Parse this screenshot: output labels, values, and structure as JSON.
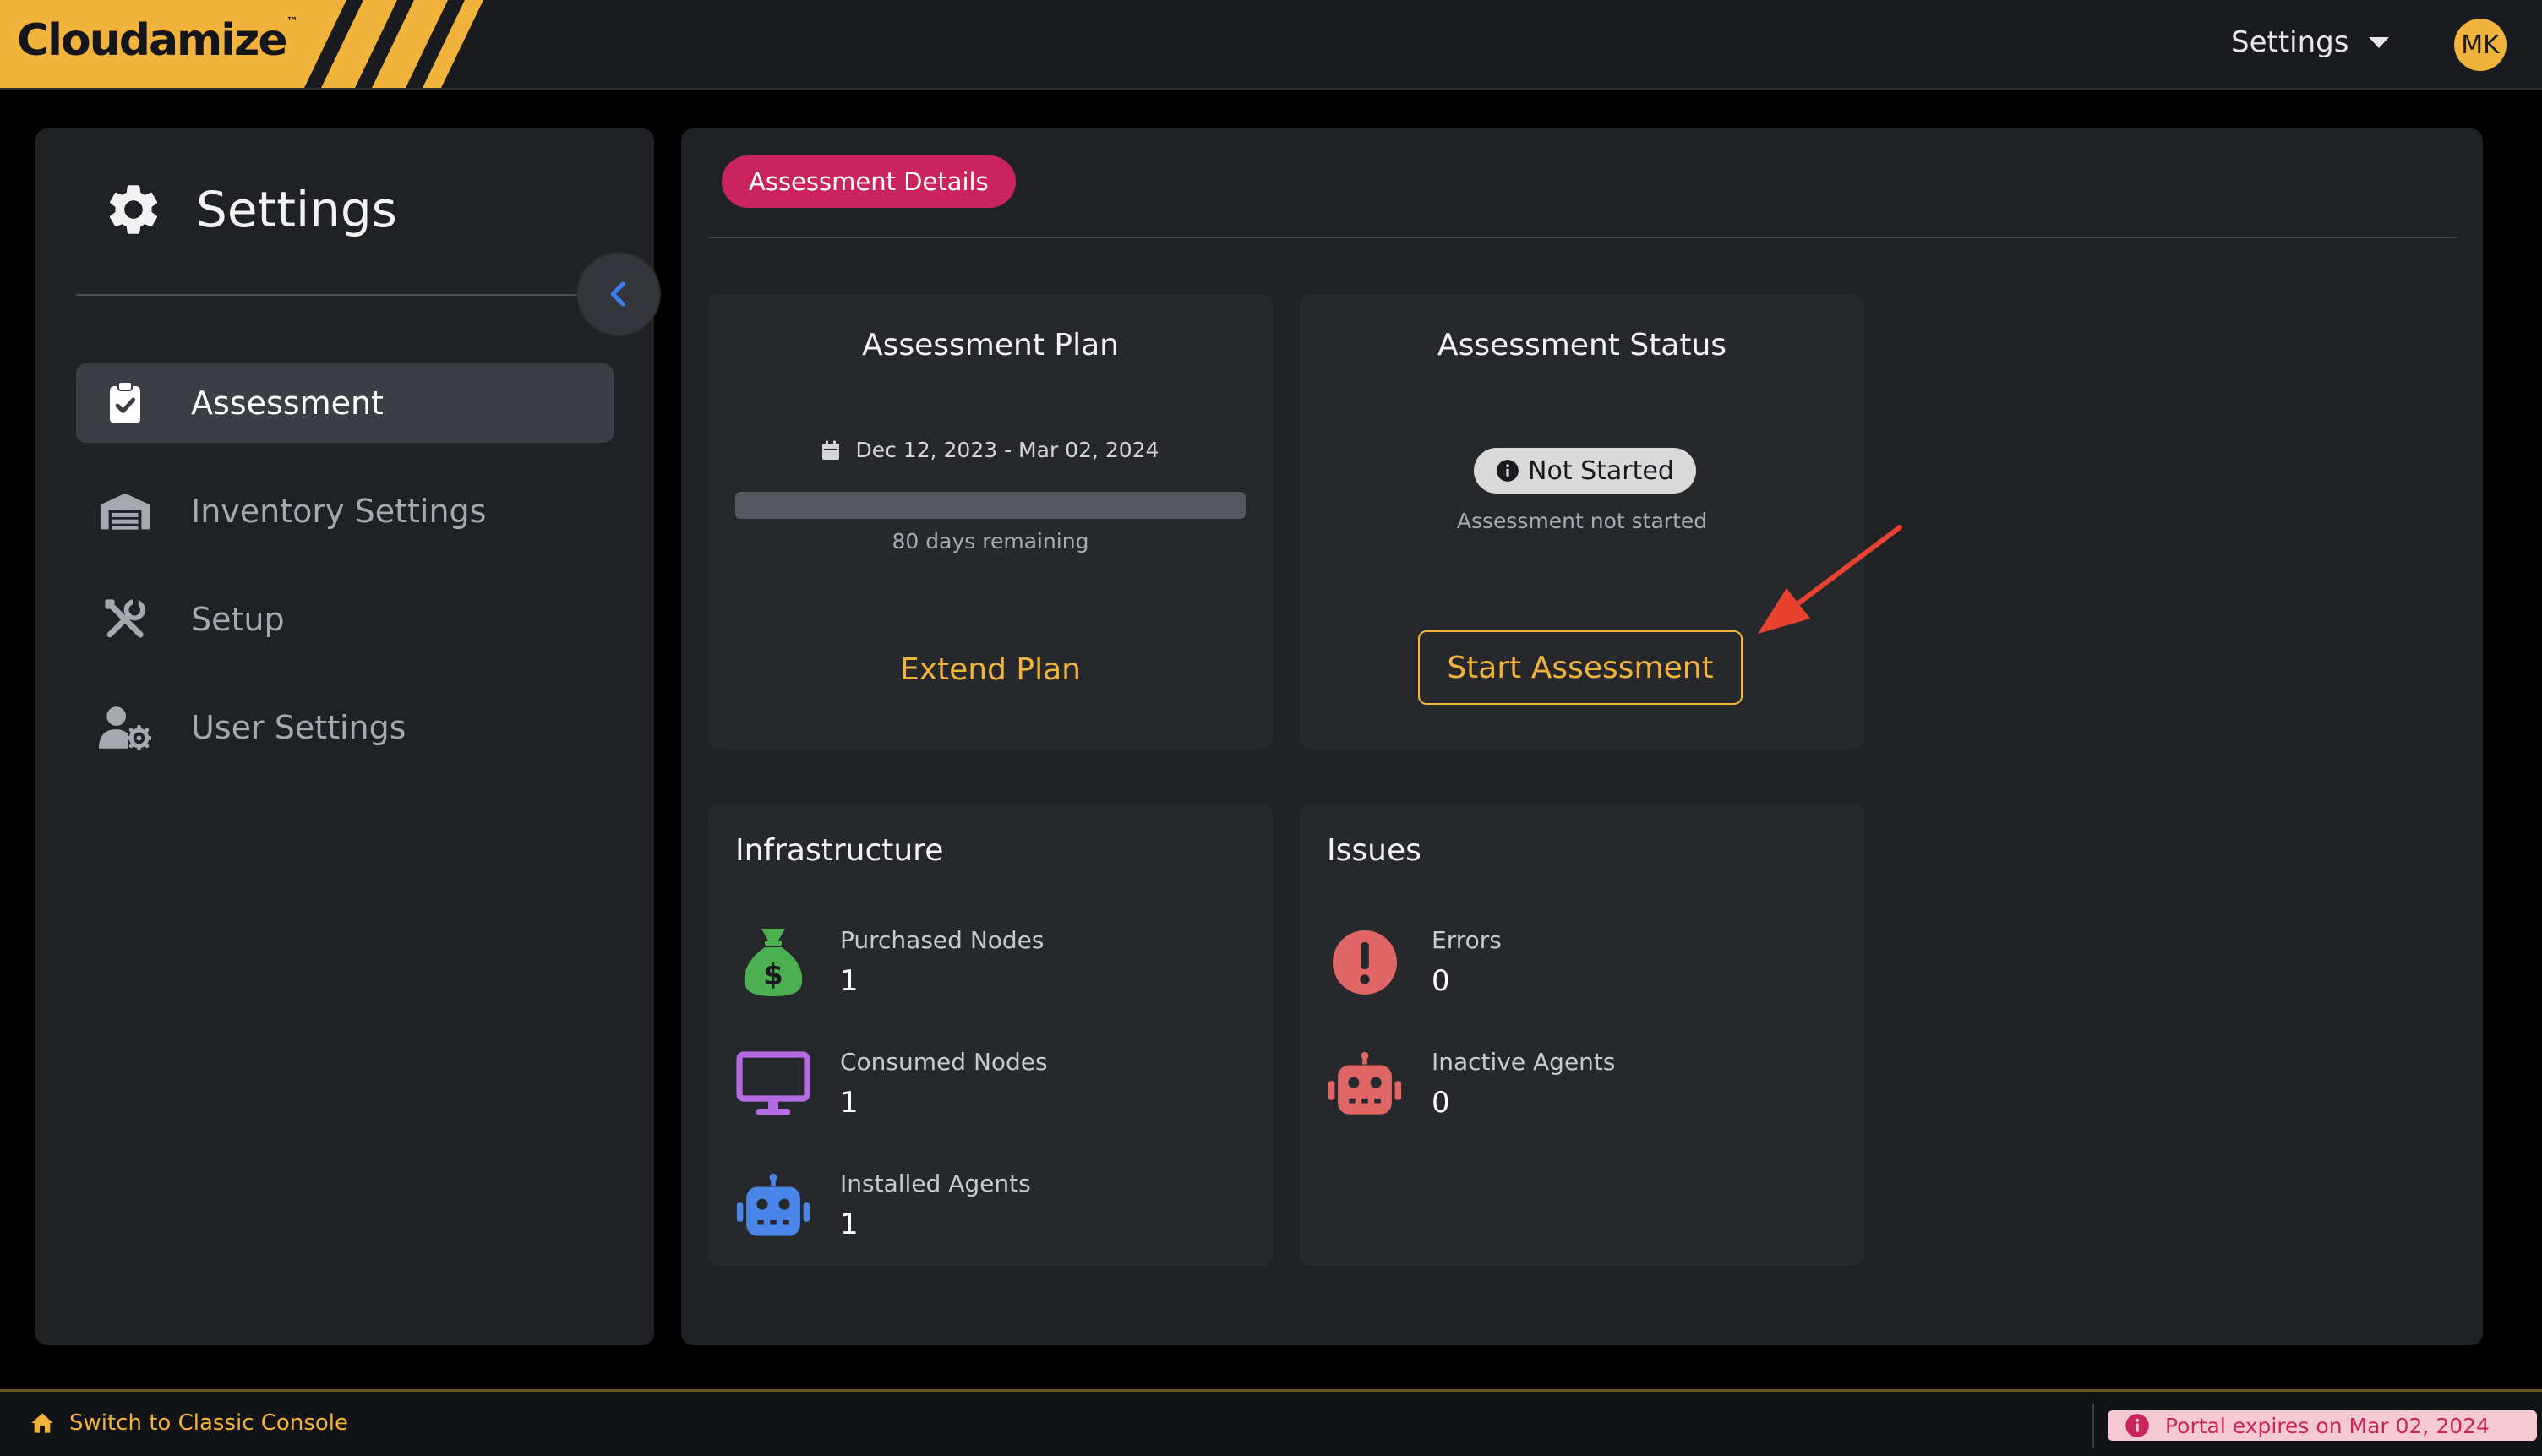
{
  "app": {
    "brand": "Cloudamize",
    "brand_mark": "™",
    "brand_color": "#f2b33d"
  },
  "header": {
    "settings_label": "Settings",
    "avatar_initials": "MK"
  },
  "sidebar": {
    "title": "Settings",
    "items": [
      {
        "label": "Assessment",
        "icon": "clipboard-check-icon",
        "active": true
      },
      {
        "label": "Inventory Settings",
        "icon": "warehouse-icon",
        "active": false
      },
      {
        "label": "Setup",
        "icon": "tools-icon",
        "active": false
      },
      {
        "label": "User Settings",
        "icon": "user-gear-icon",
        "active": false
      }
    ]
  },
  "main": {
    "tab_label": "Assessment Details",
    "plan": {
      "title": "Assessment Plan",
      "date_range": "Dec 12, 2023 - Mar 02, 2024",
      "progress_fraction": 0.0,
      "remaining": "80 days remaining",
      "extend_label": "Extend Plan"
    },
    "status": {
      "title": "Assessment Status",
      "badge": "Not Started",
      "subtitle": "Assessment not started",
      "start_label": "Start Assessment"
    },
    "infrastructure": {
      "title": "Infrastructure",
      "metrics": [
        {
          "label": "Purchased Nodes",
          "value": "1",
          "icon": "money-bag-icon",
          "color": "#4caf50"
        },
        {
          "label": "Consumed Nodes",
          "value": "1",
          "icon": "monitor-icon",
          "color": "#b36ae2"
        },
        {
          "label": "Installed Agents",
          "value": "1",
          "icon": "robot-icon",
          "color": "#4a86e8"
        }
      ]
    },
    "issues": {
      "title": "Issues",
      "metrics": [
        {
          "label": "Errors",
          "value": "0",
          "icon": "exclamation-circle-icon",
          "color": "#e06666"
        },
        {
          "label": "Inactive Agents",
          "value": "0",
          "icon": "robot-icon",
          "color": "#e06666"
        }
      ]
    }
  },
  "footer": {
    "classic_label": "Switch to Classic Console",
    "expire_text": "Portal expires on Mar 02, 2024"
  }
}
